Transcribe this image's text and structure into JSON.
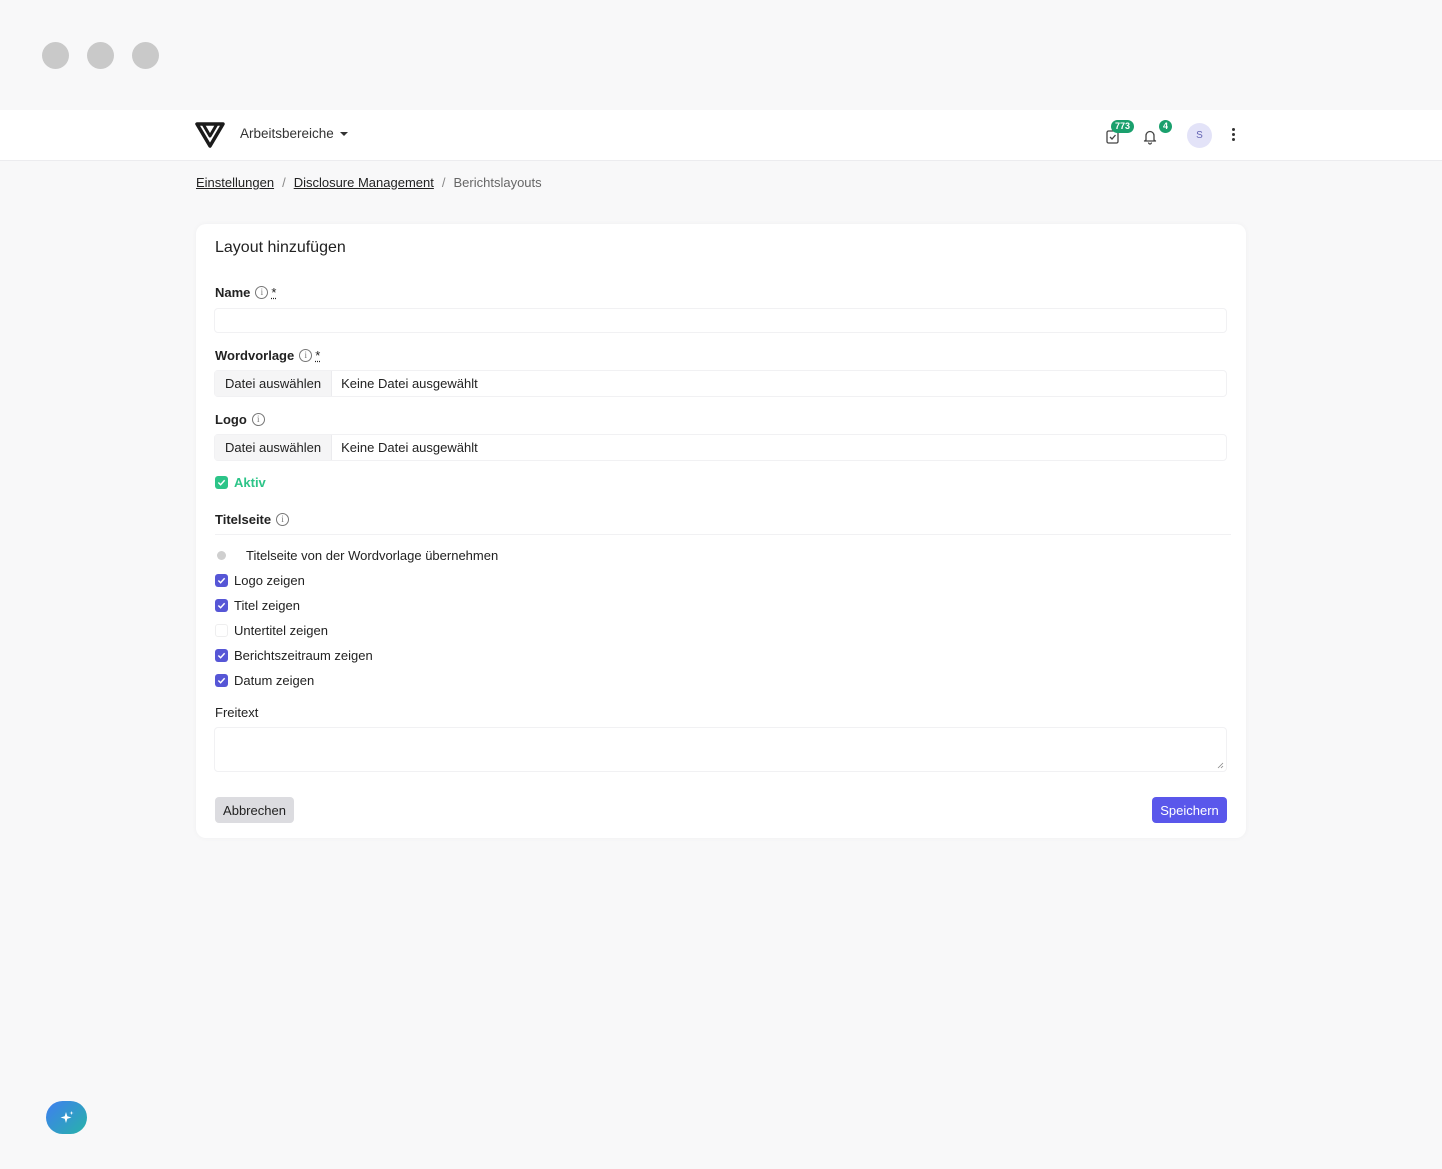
{
  "header": {
    "workspace_label": "Arbeitsbereiche",
    "tasks_count": "773",
    "notifications_count": "4",
    "avatar_initial": "S",
    "badge_color": "#1aa06d"
  },
  "breadcrumb": {
    "items": [
      "Einstellungen",
      "Disclosure Management"
    ],
    "current": "Berichtslayouts",
    "separator": "/"
  },
  "form": {
    "title": "Layout hinzufügen",
    "name_label": "Name",
    "name_value": "",
    "required_marker": "*",
    "wordvorlage_label": "Wordvorlage",
    "logo_label": "Logo",
    "file_button_label": "Datei auswählen",
    "file_none_label": "Keine Datei ausgewählt",
    "aktiv_label": "Aktiv",
    "aktiv_checked": true,
    "titelseite_label": "Titelseite",
    "titelseite_option": "Titelseite von der Wordvorlage übernehmen",
    "options": [
      {
        "label": "Logo zeigen",
        "checked": true
      },
      {
        "label": "Titel zeigen",
        "checked": true
      },
      {
        "label": "Untertitel zeigen",
        "checked": false
      },
      {
        "label": "Berichtszeitraum zeigen",
        "checked": true
      },
      {
        "label": "Datum zeigen",
        "checked": true
      }
    ],
    "freitext_label": "Freitext",
    "freitext_value": "",
    "cancel_label": "Abbrechen",
    "save_label": "Speichern",
    "accent_color": "#5a57eb",
    "active_color": "#2cc488"
  },
  "icons": {
    "logo": "brand-logo-icon",
    "tasks": "clipboard-check-icon",
    "notifications": "bell-icon",
    "menu": "kebab-menu-icon",
    "info": "info-icon",
    "assistant": "sparkle-icon"
  }
}
